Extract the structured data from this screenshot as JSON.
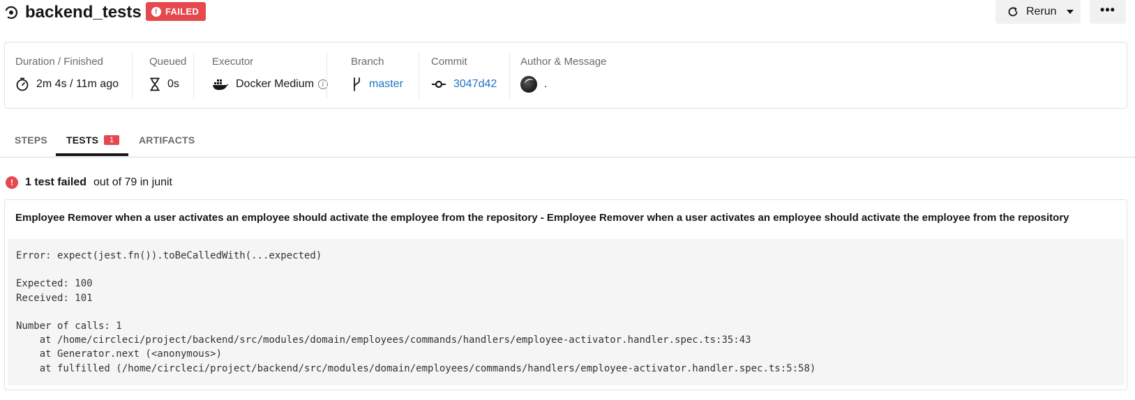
{
  "header": {
    "job_name": "backend_tests",
    "status": "FAILED",
    "rerun_label": "Rerun",
    "more_label": "•••"
  },
  "info": {
    "duration": {
      "label": "Duration / Finished",
      "value": "2m 4s / 11m ago"
    },
    "queued": {
      "label": "Queued",
      "value": "0s"
    },
    "executor": {
      "label": "Executor",
      "value": "Docker Medium"
    },
    "branch": {
      "label": "Branch",
      "value": "master"
    },
    "commit": {
      "label": "Commit",
      "value": "3047d42"
    },
    "author": {
      "label": "Author & Message",
      "message": "."
    }
  },
  "tabs": [
    {
      "label": "STEPS"
    },
    {
      "label": "TESTS",
      "count": "1"
    },
    {
      "label": "ARTIFACTS"
    }
  ],
  "summary": {
    "failed": "1 test failed",
    "rest": "out of 79 in junit"
  },
  "failure": {
    "title": "Employee Remover when a user activates an employee should activate the employee from the repository - Employee Remover when a user activates an employee should activate the employee from the repository",
    "lines": [
      "Error: expect(jest.fn()).toBeCalledWith(...expected)",
      "",
      "Expected: 100",
      "Received: 101",
      "",
      "Number of calls: 1",
      "    at /home/circleci/project/backend/src/modules/domain/employees/commands/handlers/employee-activator.handler.spec.ts:35:43",
      "    at Generator.next (<anonymous>)",
      "    at fulfilled (/home/circleci/project/backend/src/modules/domain/employees/commands/handlers/employee-activator.handler.spec.ts:5:58)"
    ]
  },
  "colors": {
    "failed_red": "#e5484d",
    "link_blue": "#1f72c4",
    "code_bg": "#f5f5f5"
  }
}
